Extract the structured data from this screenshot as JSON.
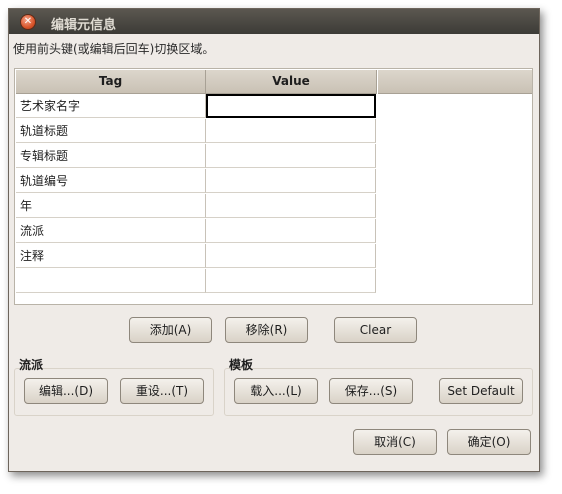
{
  "window": {
    "title": "编辑元信息"
  },
  "hint": "使用前头键(或编辑后回车)切换区域。",
  "table": {
    "headers": {
      "tag": "Tag",
      "value": "Value"
    },
    "rows": [
      {
        "tag": "艺术家名字",
        "value": ""
      },
      {
        "tag": "轨道标题",
        "value": ""
      },
      {
        "tag": "专辑标题",
        "value": ""
      },
      {
        "tag": "轨道编号",
        "value": ""
      },
      {
        "tag": "年",
        "value": ""
      },
      {
        "tag": "流派",
        "value": ""
      },
      {
        "tag": "注释",
        "value": ""
      },
      {
        "tag": "",
        "value": ""
      }
    ]
  },
  "row_buttons": {
    "add": "添加(A)",
    "remove": "移除(R)",
    "clear": "Clear"
  },
  "genre_group": {
    "title": "流派",
    "edit": "编辑...(D)",
    "reset": "重设...(T)"
  },
  "template_group": {
    "title": "模板",
    "load": "载入...(L)",
    "save": "保存...(S)",
    "set_default": "Set Default"
  },
  "dialog_buttons": {
    "cancel": "取消(C)",
    "ok": "确定(O)"
  }
}
